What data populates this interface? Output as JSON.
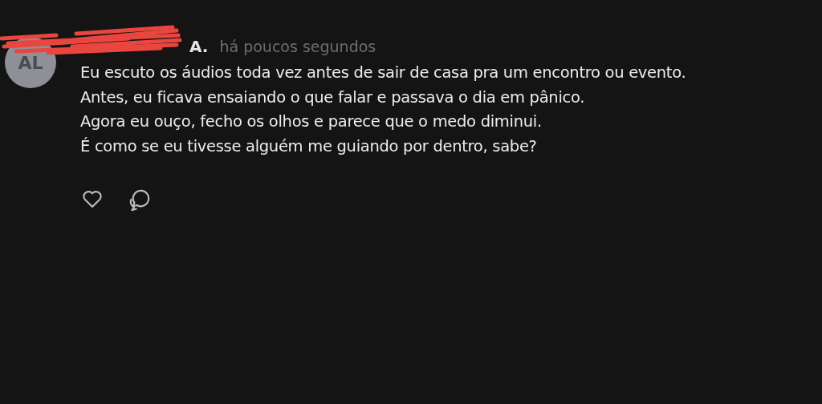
{
  "comment": {
    "avatar": {
      "initials": "AL"
    },
    "author": "A.",
    "time": "há poucos segundos",
    "lines": [
      "Eu escuto os áudios toda vez antes de sair de casa pra um encontro ou evento.",
      "Antes, eu ficava ensaiando o que falar e passava o dia em pânico.",
      "Agora eu ouço, fecho os olhos e parece que o medo diminui.",
      "É como se eu tivesse alguém me guiando por dentro, sabe?"
    ],
    "liked": false
  }
}
